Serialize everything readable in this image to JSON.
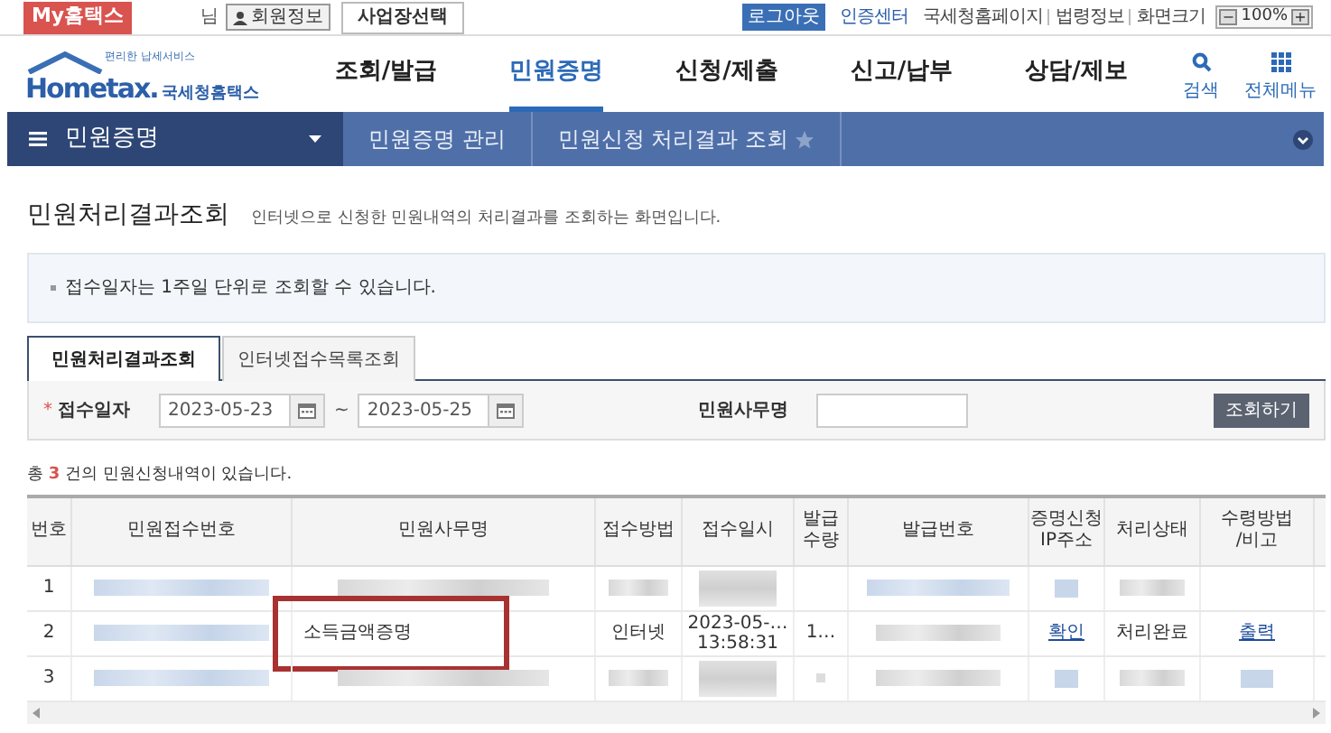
{
  "top_bar": {
    "my_button": "My홈택스",
    "user_suffix": "님",
    "member_button": "회원정보",
    "business_button": "사업장선택",
    "logout": "로그아웃",
    "links": [
      "인증센터",
      "국세청홈페이지",
      "법령정보",
      "화면크기"
    ],
    "zoom": {
      "minus": "−",
      "value": "100%",
      "plus": "+"
    }
  },
  "header": {
    "logo_tagline": "편리한 납세서비스",
    "logo_text": "Hometax.",
    "logo_name": "국세청홈택스",
    "menu": [
      {
        "label": "조회/발급",
        "selected": false
      },
      {
        "label": "민원증명",
        "selected": true
      },
      {
        "label": "신청/제출",
        "selected": false
      },
      {
        "label": "신고/납부",
        "selected": false
      },
      {
        "label": "상담/제보",
        "selected": false
      }
    ],
    "search": "검색",
    "all_menu": "전체메뉴"
  },
  "breadcrumb": {
    "section": "민원증명",
    "items": [
      "민원증명 관리",
      "민원신청 처리결과 조회"
    ],
    "favorite": false
  },
  "page": {
    "title": "민원처리결과조회",
    "description": "인터넷으로 신청한 민원내역의 처리결과를 조회하는 화면입니다."
  },
  "notice": "접수일자는 1주일 단위로 조회할 수 있습니다.",
  "tabs": [
    {
      "label": "민원처리결과조회",
      "selected": true
    },
    {
      "label": "인터넷접수목록조회",
      "selected": false
    }
  ],
  "search_form": {
    "required_mark": "*",
    "date_label": "접수일자",
    "date_from": "2023-05-23",
    "date_to": "2023-05-25",
    "separator": "~",
    "name_label": "민원사무명",
    "submit": "조회하기"
  },
  "result_count": {
    "prefix": "총",
    "count": "3",
    "suffix": "건의 민원신청내역이 있습니다."
  },
  "table": {
    "columns": [
      "번호",
      "민원접수번호",
      "민원사무명",
      "접수방법",
      "접수일시",
      "발급\n수량",
      "발급번호",
      "증명신청\nIP주소",
      "처리상태",
      "수령방법\n/비고"
    ],
    "rows": [
      {
        "cells": [
          {
            "kind": "text",
            "lines": [
              "1"
            ]
          },
          {
            "kind": "redacted-link"
          },
          {
            "kind": "redacted"
          },
          {
            "kind": "redacted"
          },
          {
            "kind": "redacted-tall"
          },
          {
            "kind": "empty"
          },
          {
            "kind": "redacted-link"
          },
          {
            "kind": "redacted-link-small"
          },
          {
            "kind": "redacted"
          },
          {
            "kind": "empty"
          }
        ]
      },
      {
        "cells": [
          {
            "kind": "text",
            "lines": [
              "2"
            ]
          },
          {
            "kind": "redacted-link"
          },
          {
            "kind": "text",
            "lines": [
              "소득금액증명"
            ],
            "highlighted": true
          },
          {
            "kind": "text",
            "lines": [
              "인터넷"
            ]
          },
          {
            "kind": "text",
            "lines": [
              "2023-05-…",
              "13:58:31"
            ]
          },
          {
            "kind": "text",
            "lines": [
              "1…"
            ]
          },
          {
            "kind": "redacted"
          },
          {
            "kind": "link",
            "lines": [
              "확인"
            ]
          },
          {
            "kind": "text",
            "lines": [
              "처리완료"
            ]
          },
          {
            "kind": "link",
            "lines": [
              "출력"
            ]
          }
        ]
      },
      {
        "cells": [
          {
            "kind": "text",
            "lines": [
              "3"
            ]
          },
          {
            "kind": "redacted-link"
          },
          {
            "kind": "redacted"
          },
          {
            "kind": "redacted"
          },
          {
            "kind": "redacted-tall"
          },
          {
            "kind": "redacted-dot"
          },
          {
            "kind": "redacted"
          },
          {
            "kind": "redacted-link-small"
          },
          {
            "kind": "redacted"
          },
          {
            "kind": "redacted-link-small"
          }
        ]
      }
    ]
  }
}
